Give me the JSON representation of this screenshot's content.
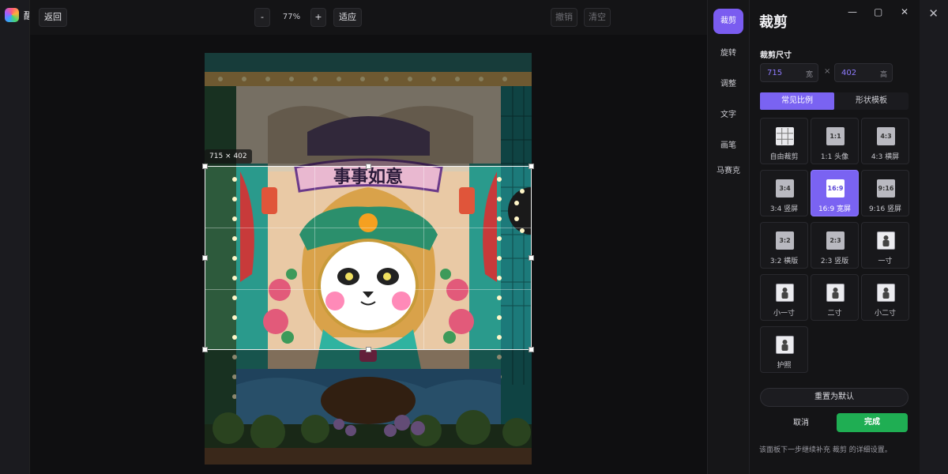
{
  "app": {
    "title_char": "醒",
    "close_glyph": "✕"
  },
  "toolbar": {
    "back_label": "返回",
    "zoom_out_label": "-",
    "zoom_value": "77%",
    "zoom_in_label": "+",
    "fit_label": "适应",
    "undo_label": "撤销",
    "clear_label": "清空"
  },
  "canvas": {
    "size_tag": "715 × 402",
    "banner_text": "事事如意"
  },
  "tools": [
    {
      "label": "裁剪",
      "active": true
    },
    {
      "label": "旋转",
      "active": false
    },
    {
      "label": "调整",
      "active": false
    },
    {
      "label": "文字",
      "active": false
    },
    {
      "label": "画笔",
      "active": false
    },
    {
      "label": "马赛克",
      "active": false
    }
  ],
  "panel": {
    "title": "裁剪",
    "window_controls": {
      "minimize": "—",
      "maximize": "▢",
      "close": "✕"
    },
    "size_section_label": "裁剪尺寸",
    "width_value": "715",
    "width_unit": "宽",
    "times": "×",
    "height_value": "402",
    "height_unit": "高",
    "tabs": [
      {
        "label": "常见比例",
        "active": true
      },
      {
        "label": "形状模板",
        "active": false
      }
    ],
    "ratios": [
      {
        "icon": "grid",
        "icon_text": "",
        "label": "自由裁剪",
        "active": false
      },
      {
        "icon": "ratio",
        "icon_text": "1:1",
        "label": "1:1 头像",
        "active": false
      },
      {
        "icon": "ratio",
        "icon_text": "4:3",
        "label": "4:3 横屏",
        "active": false
      },
      {
        "icon": "ratio",
        "icon_text": "3:4",
        "label": "3:4 竖屏",
        "active": false
      },
      {
        "icon": "ratio",
        "icon_text": "16:9",
        "label": "16:9 宽屏",
        "active": true
      },
      {
        "icon": "ratio",
        "icon_text": "9:16",
        "label": "9:16 竖屏",
        "active": false
      },
      {
        "icon": "ratio",
        "icon_text": "3:2",
        "label": "3:2 横版",
        "active": false
      },
      {
        "icon": "ratio",
        "icon_text": "2:3",
        "label": "2:3 竖版",
        "active": false
      },
      {
        "icon": "person",
        "icon_text": "",
        "label": "一寸",
        "active": false
      },
      {
        "icon": "person",
        "icon_text": "",
        "label": "小一寸",
        "active": false
      },
      {
        "icon": "person",
        "icon_text": "",
        "label": "二寸",
        "active": false
      },
      {
        "icon": "person",
        "icon_text": "",
        "label": "小二寸",
        "active": false
      },
      {
        "icon": "person",
        "icon_text": "",
        "label": "护照",
        "active": false
      }
    ],
    "reset_label": "重置为默认",
    "cancel_label": "取消",
    "done_label": "完成",
    "hint": "该面板下一步继续补充 裁剪 的详细设置。"
  },
  "colors": {
    "accent": "#7a63f2",
    "done_green": "#1fae53"
  }
}
